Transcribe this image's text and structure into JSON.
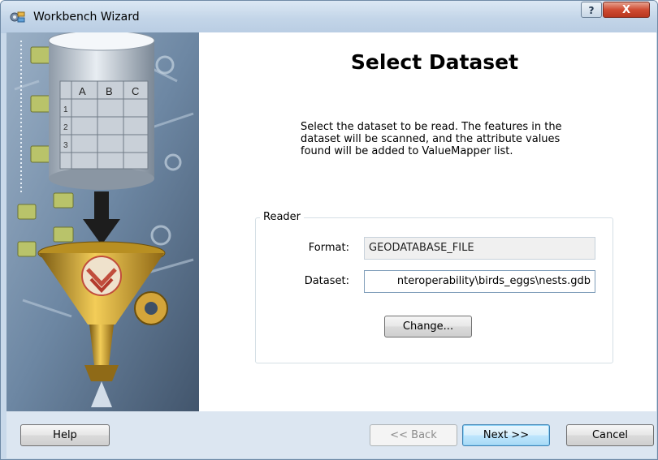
{
  "window": {
    "title": "Workbench Wizard",
    "help_glyph": "?",
    "close_glyph": "X"
  },
  "page": {
    "heading": "Select Dataset",
    "description": "Select the dataset to be read.  The features in the dataset will be scanned, and the attribute values found will be added to ValueMapper list."
  },
  "reader": {
    "group_label": "Reader",
    "format_label": "Format:",
    "format_value": "GEODATABASE_FILE",
    "dataset_label": "Dataset:",
    "dataset_value": "nteroperability\\birds_eggs\\nests.gdb",
    "change_button": "Change..."
  },
  "buttons": {
    "help": "Help",
    "back": "<< Back",
    "next": "Next >>",
    "cancel": "Cancel"
  },
  "side_image": {
    "spreadsheet_columns": [
      "A",
      "B",
      "C"
    ],
    "spreadsheet_rows": [
      "1",
      "2",
      "3"
    ]
  },
  "colors": {
    "titlebar": "#c3d5e8",
    "close_button": "#cf4b32",
    "default_button_border": "#3c7fb1"
  },
  "icons": {
    "app": "workbench-icon",
    "help": "help-question-icon",
    "close": "close-x-icon"
  }
}
